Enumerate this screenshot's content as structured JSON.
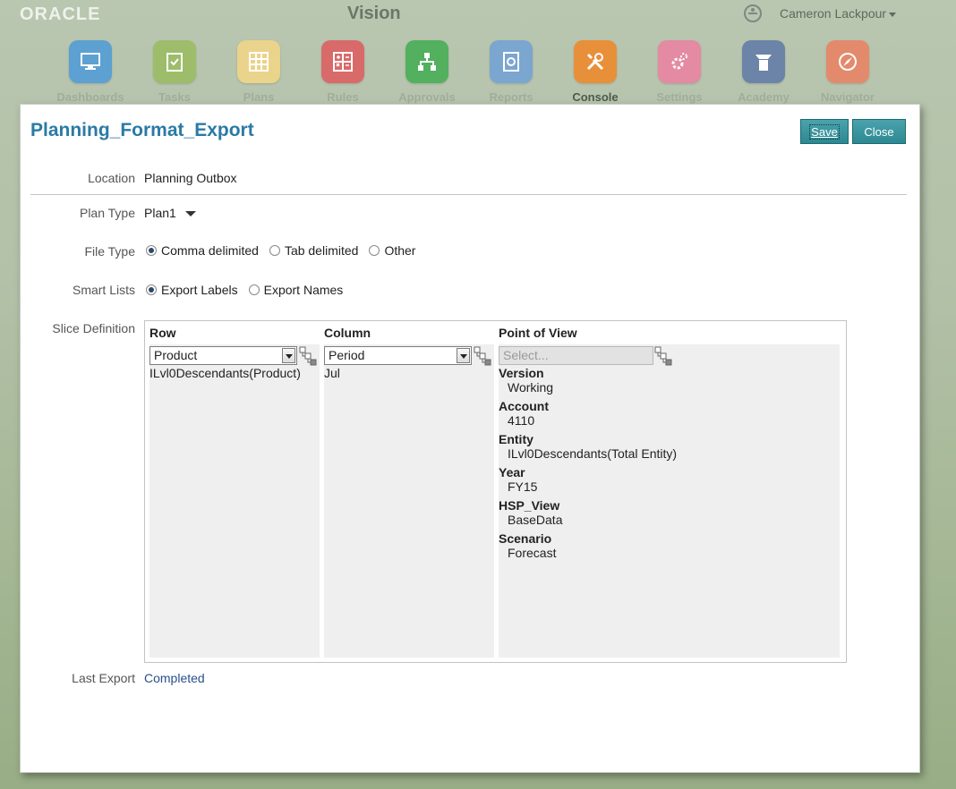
{
  "header": {
    "logo": "ORACLE",
    "app_name": "Vision",
    "user": "Cameron Lackpour"
  },
  "nav": [
    {
      "label": "Dashboards",
      "color": "#3f8fc9",
      "icon": "dashboard-icon"
    },
    {
      "label": "Tasks",
      "color": "#88b04a",
      "icon": "task-clipboard-icon"
    },
    {
      "label": "Plans",
      "color": "#e7c75c",
      "icon": "grid-icon"
    },
    {
      "label": "Rules",
      "color": "#d94a4a",
      "icon": "calculator-icon"
    },
    {
      "label": "Approvals",
      "color": "#3fae4d",
      "icon": "hierarchy-icon"
    },
    {
      "label": "Reports",
      "color": "#5e9ad2",
      "icon": "report-icon"
    },
    {
      "label": "Console",
      "color": "#e58a2b",
      "icon": "tools-icon"
    },
    {
      "label": "Settings",
      "color": "#e46b8e",
      "icon": "gears-icon"
    },
    {
      "label": "Academy",
      "color": "#4c6b99",
      "icon": "academy-icon"
    },
    {
      "label": "Navigator",
      "color": "#e06a47",
      "icon": "compass-icon"
    }
  ],
  "dialog": {
    "title": "Planning_Format_Export",
    "save_label": "Save",
    "close_label": "Close",
    "location_label": "Location",
    "location_value": "Planning Outbox",
    "plan_type_label": "Plan Type",
    "plan_type_value": "Plan1",
    "file_type_label": "File Type",
    "file_type_options": [
      "Comma delimited",
      "Tab delimited",
      "Other"
    ],
    "smart_lists_label": "Smart Lists",
    "smart_lists_options": [
      "Export Labels",
      "Export Names"
    ],
    "slice_label": "Slice Definition",
    "last_export_label": "Last Export",
    "last_export_value": "Completed"
  },
  "slice": {
    "row": {
      "header": "Row",
      "dimension": "Product",
      "member": "ILvl0Descendants(Product)"
    },
    "column": {
      "header": "Column",
      "dimension": "Period",
      "member": "Jul"
    },
    "pov": {
      "header": "Point of View",
      "placeholder": "Select...",
      "items": [
        {
          "dim": "Version",
          "val": "Working"
        },
        {
          "dim": "Account",
          "val": "4110"
        },
        {
          "dim": "Entity",
          "val": "ILvl0Descendants(Total Entity)"
        },
        {
          "dim": "Year",
          "val": "FY15"
        },
        {
          "dim": "HSP_View",
          "val": "BaseData"
        },
        {
          "dim": "Scenario",
          "val": "Forecast"
        }
      ]
    }
  }
}
